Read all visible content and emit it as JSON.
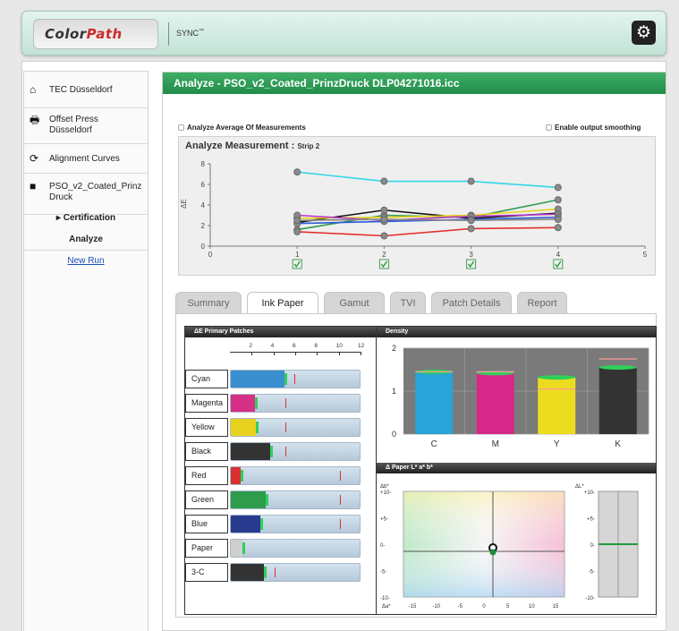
{
  "app": {
    "logo_prefix": "Color",
    "logo_suffix": "Path",
    "sync_label": "SYNC",
    "sync_mark": "™"
  },
  "sidebar": {
    "items": [
      {
        "label": "TEC Düsseldorf",
        "icon": "home-icon"
      },
      {
        "label": "Offset Press Düsseldorf",
        "icon": "printer-icon"
      },
      {
        "label": "Alignment Curves",
        "icon": "refresh-icon"
      },
      {
        "label": "PSO_v2_Coated_PrinzDruck",
        "icon": "folder-icon"
      }
    ],
    "certification": "Certification",
    "analyze": "Analyze",
    "new_run": "New Run"
  },
  "panel": {
    "title": "Analyze - PSO_v2_Coated_PrinzDruck DLP04271016.icc",
    "opt_average": "Analyze Average Of Measurements",
    "opt_smoothing": "Enable output smoothing"
  },
  "measurement": {
    "title": "Analyze Measurement : ",
    "strip": "Strip 2",
    "ylabel": "ΔE"
  },
  "tabs": [
    {
      "label": "Summary",
      "active": false
    },
    {
      "label": "Ink Paper",
      "active": true
    },
    {
      "label": "Gamut",
      "active": false
    },
    {
      "label": "TVI",
      "active": false
    },
    {
      "label": "Patch Details",
      "active": false
    },
    {
      "label": "Report",
      "active": false
    }
  ],
  "delta_e": {
    "header": "ΔE Primary Patches",
    "ticks": [
      "2",
      "4",
      "6",
      "8",
      "10",
      "12"
    ],
    "rows": [
      {
        "label": "Cyan",
        "value": 4.9,
        "target": 5.8,
        "color": "#3b8fcf"
      },
      {
        "label": "Magenta",
        "value": 2.2,
        "target": 5.0,
        "color": "#d62f86"
      },
      {
        "label": "Yellow",
        "value": 2.3,
        "target": 5.0,
        "color": "#e8d21e"
      },
      {
        "label": "Black",
        "value": 3.6,
        "target": 5.0,
        "color": "#333333"
      },
      {
        "label": "Red",
        "value": 0.9,
        "target": 10.0,
        "color": "#d93030"
      },
      {
        "label": "Green",
        "value": 3.2,
        "target": 10.0,
        "color": "#2e9b4d"
      },
      {
        "label": "Blue",
        "value": 2.7,
        "target": 10.0,
        "color": "#2a3a8e"
      },
      {
        "label": "Paper",
        "value": 1.1,
        "target": 0,
        "color": "#cfcfcf"
      },
      {
        "label": "3-C",
        "value": 3.0,
        "target": 4.0,
        "color": "#333333"
      }
    ]
  },
  "density_header": "Density",
  "paper_header": "Δ Paper L* a* b*",
  "ab_plot": {
    "ylabel": "Δb*",
    "xlabel": "Δa*",
    "y_ticks": [
      "+10-",
      "+5-",
      "0-",
      "-5-",
      "-10-"
    ],
    "x_ticks": [
      "-15",
      "-10",
      "-5",
      "0",
      "5",
      "10",
      "15"
    ],
    "point": {
      "a": 0,
      "b": 0
    }
  },
  "l_plot": {
    "label": "ΔL*",
    "ticks": [
      "+10-",
      "+5-",
      "0-",
      "-5-",
      "-10-"
    ],
    "value": 0
  },
  "chart_data": [
    {
      "type": "line",
      "title": "Analyze Measurement : Strip 2",
      "ylabel": "ΔE",
      "x": [
        1,
        2,
        3,
        4
      ],
      "xlim": [
        0,
        5
      ],
      "ylim": [
        0,
        8
      ],
      "x_ticks": [
        0,
        1,
        2,
        3,
        4,
        5
      ],
      "y_ticks": [
        0,
        2,
        4,
        6,
        8
      ],
      "series": [
        {
          "color": "#33d6e8",
          "values": [
            7.2,
            6.3,
            6.3,
            5.7
          ]
        },
        {
          "color": "#2e9b4d",
          "values": [
            1.6,
            3.0,
            2.8,
            4.5
          ]
        },
        {
          "color": "#111111",
          "values": [
            2.3,
            3.5,
            2.7,
            3.2
          ]
        },
        {
          "color": "#e8d21e",
          "values": [
            2.7,
            2.8,
            3.0,
            3.6
          ]
        },
        {
          "color": "#b63ac9",
          "values": [
            3.0,
            2.5,
            2.9,
            3.1
          ]
        },
        {
          "color": "#2a5bd6",
          "values": [
            2.2,
            2.4,
            2.6,
            2.8
          ]
        },
        {
          "color": "#888888",
          "values": [
            2.5,
            2.6,
            2.5,
            2.6
          ]
        },
        {
          "color": "#e62e2e",
          "values": [
            1.4,
            1.0,
            1.7,
            1.8
          ]
        }
      ]
    },
    {
      "type": "bar",
      "title": "Density",
      "categories": [
        "C",
        "M",
        "Y",
        "K"
      ],
      "values": [
        1.45,
        1.42,
        1.32,
        1.55
      ],
      "targets": [
        1.45,
        1.45,
        1.05,
        1.75
      ],
      "colors": [
        "#2aa3d8",
        "#d7288a",
        "#ecdc1f",
        "#333333"
      ],
      "ylim": [
        0,
        2
      ],
      "y_ticks": [
        0,
        1,
        2
      ]
    }
  ]
}
